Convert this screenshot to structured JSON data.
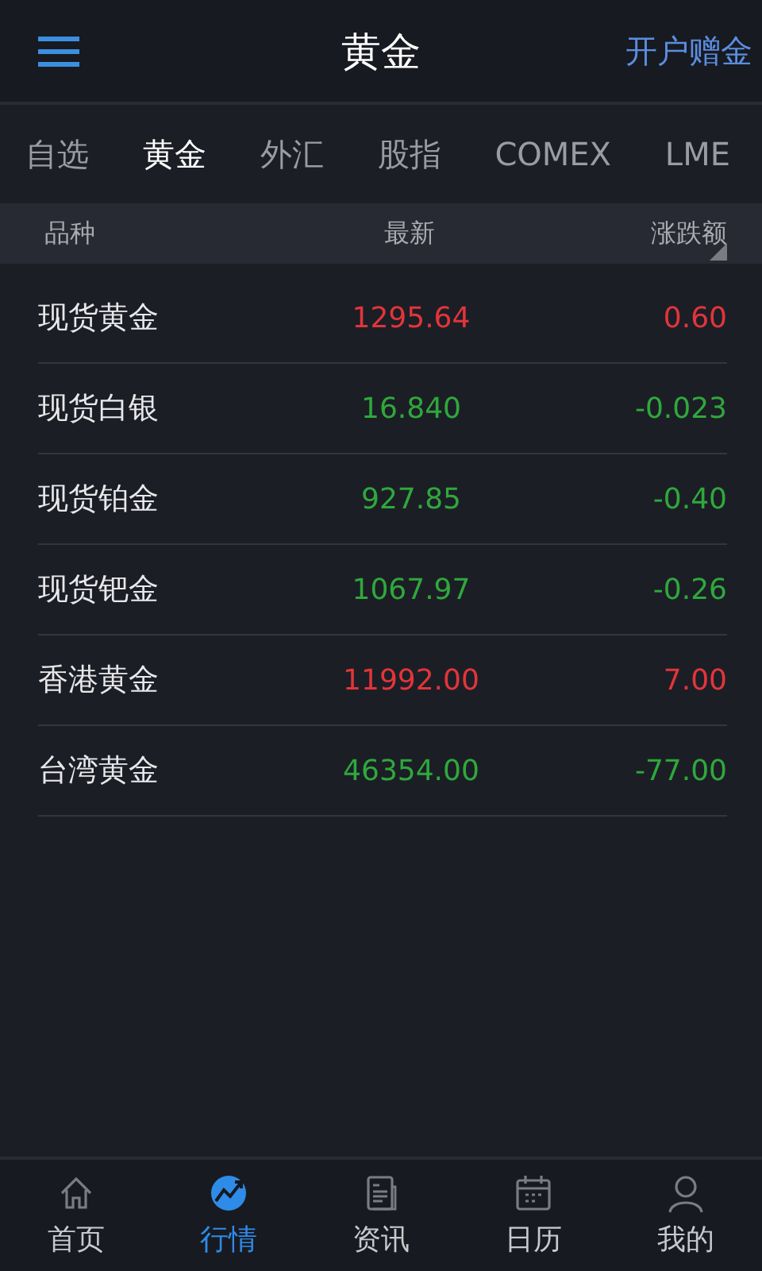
{
  "header": {
    "title": "黄金",
    "action": "开户赠金"
  },
  "tabs": [
    {
      "label": "自选",
      "selected": false
    },
    {
      "label": "黄金",
      "selected": true
    },
    {
      "label": "外汇",
      "selected": false
    },
    {
      "label": "股指",
      "selected": false
    },
    {
      "label": "COMEX",
      "selected": false
    },
    {
      "label": "LME",
      "selected": false
    }
  ],
  "table": {
    "columns": [
      "品种",
      "最新",
      "涨跌额"
    ],
    "rows": [
      {
        "name": "现货黄金",
        "price": "1295.64",
        "change": "0.60",
        "color": "#e2353a"
      },
      {
        "name": "现货白银",
        "price": "16.840",
        "change": "-0.023",
        "color": "#2fa83c"
      },
      {
        "name": "现货铂金",
        "price": "927.85",
        "change": "-0.40",
        "color": "#2fa83c"
      },
      {
        "name": "现货钯金",
        "price": "1067.97",
        "change": "-0.26",
        "color": "#2fa83c"
      },
      {
        "name": "香港黄金",
        "price": "11992.00",
        "change": "7.00",
        "color": "#e2353a"
      },
      {
        "name": "台湾黄金",
        "price": "46354.00",
        "change": "-77.00",
        "color": "#2fa83c"
      }
    ]
  },
  "bottom_nav": [
    {
      "label": "首页",
      "selected": false
    },
    {
      "label": "行情",
      "selected": true
    },
    {
      "label": "资讯",
      "selected": false
    },
    {
      "label": "日历",
      "selected": false
    },
    {
      "label": "我的",
      "selected": false
    }
  ]
}
